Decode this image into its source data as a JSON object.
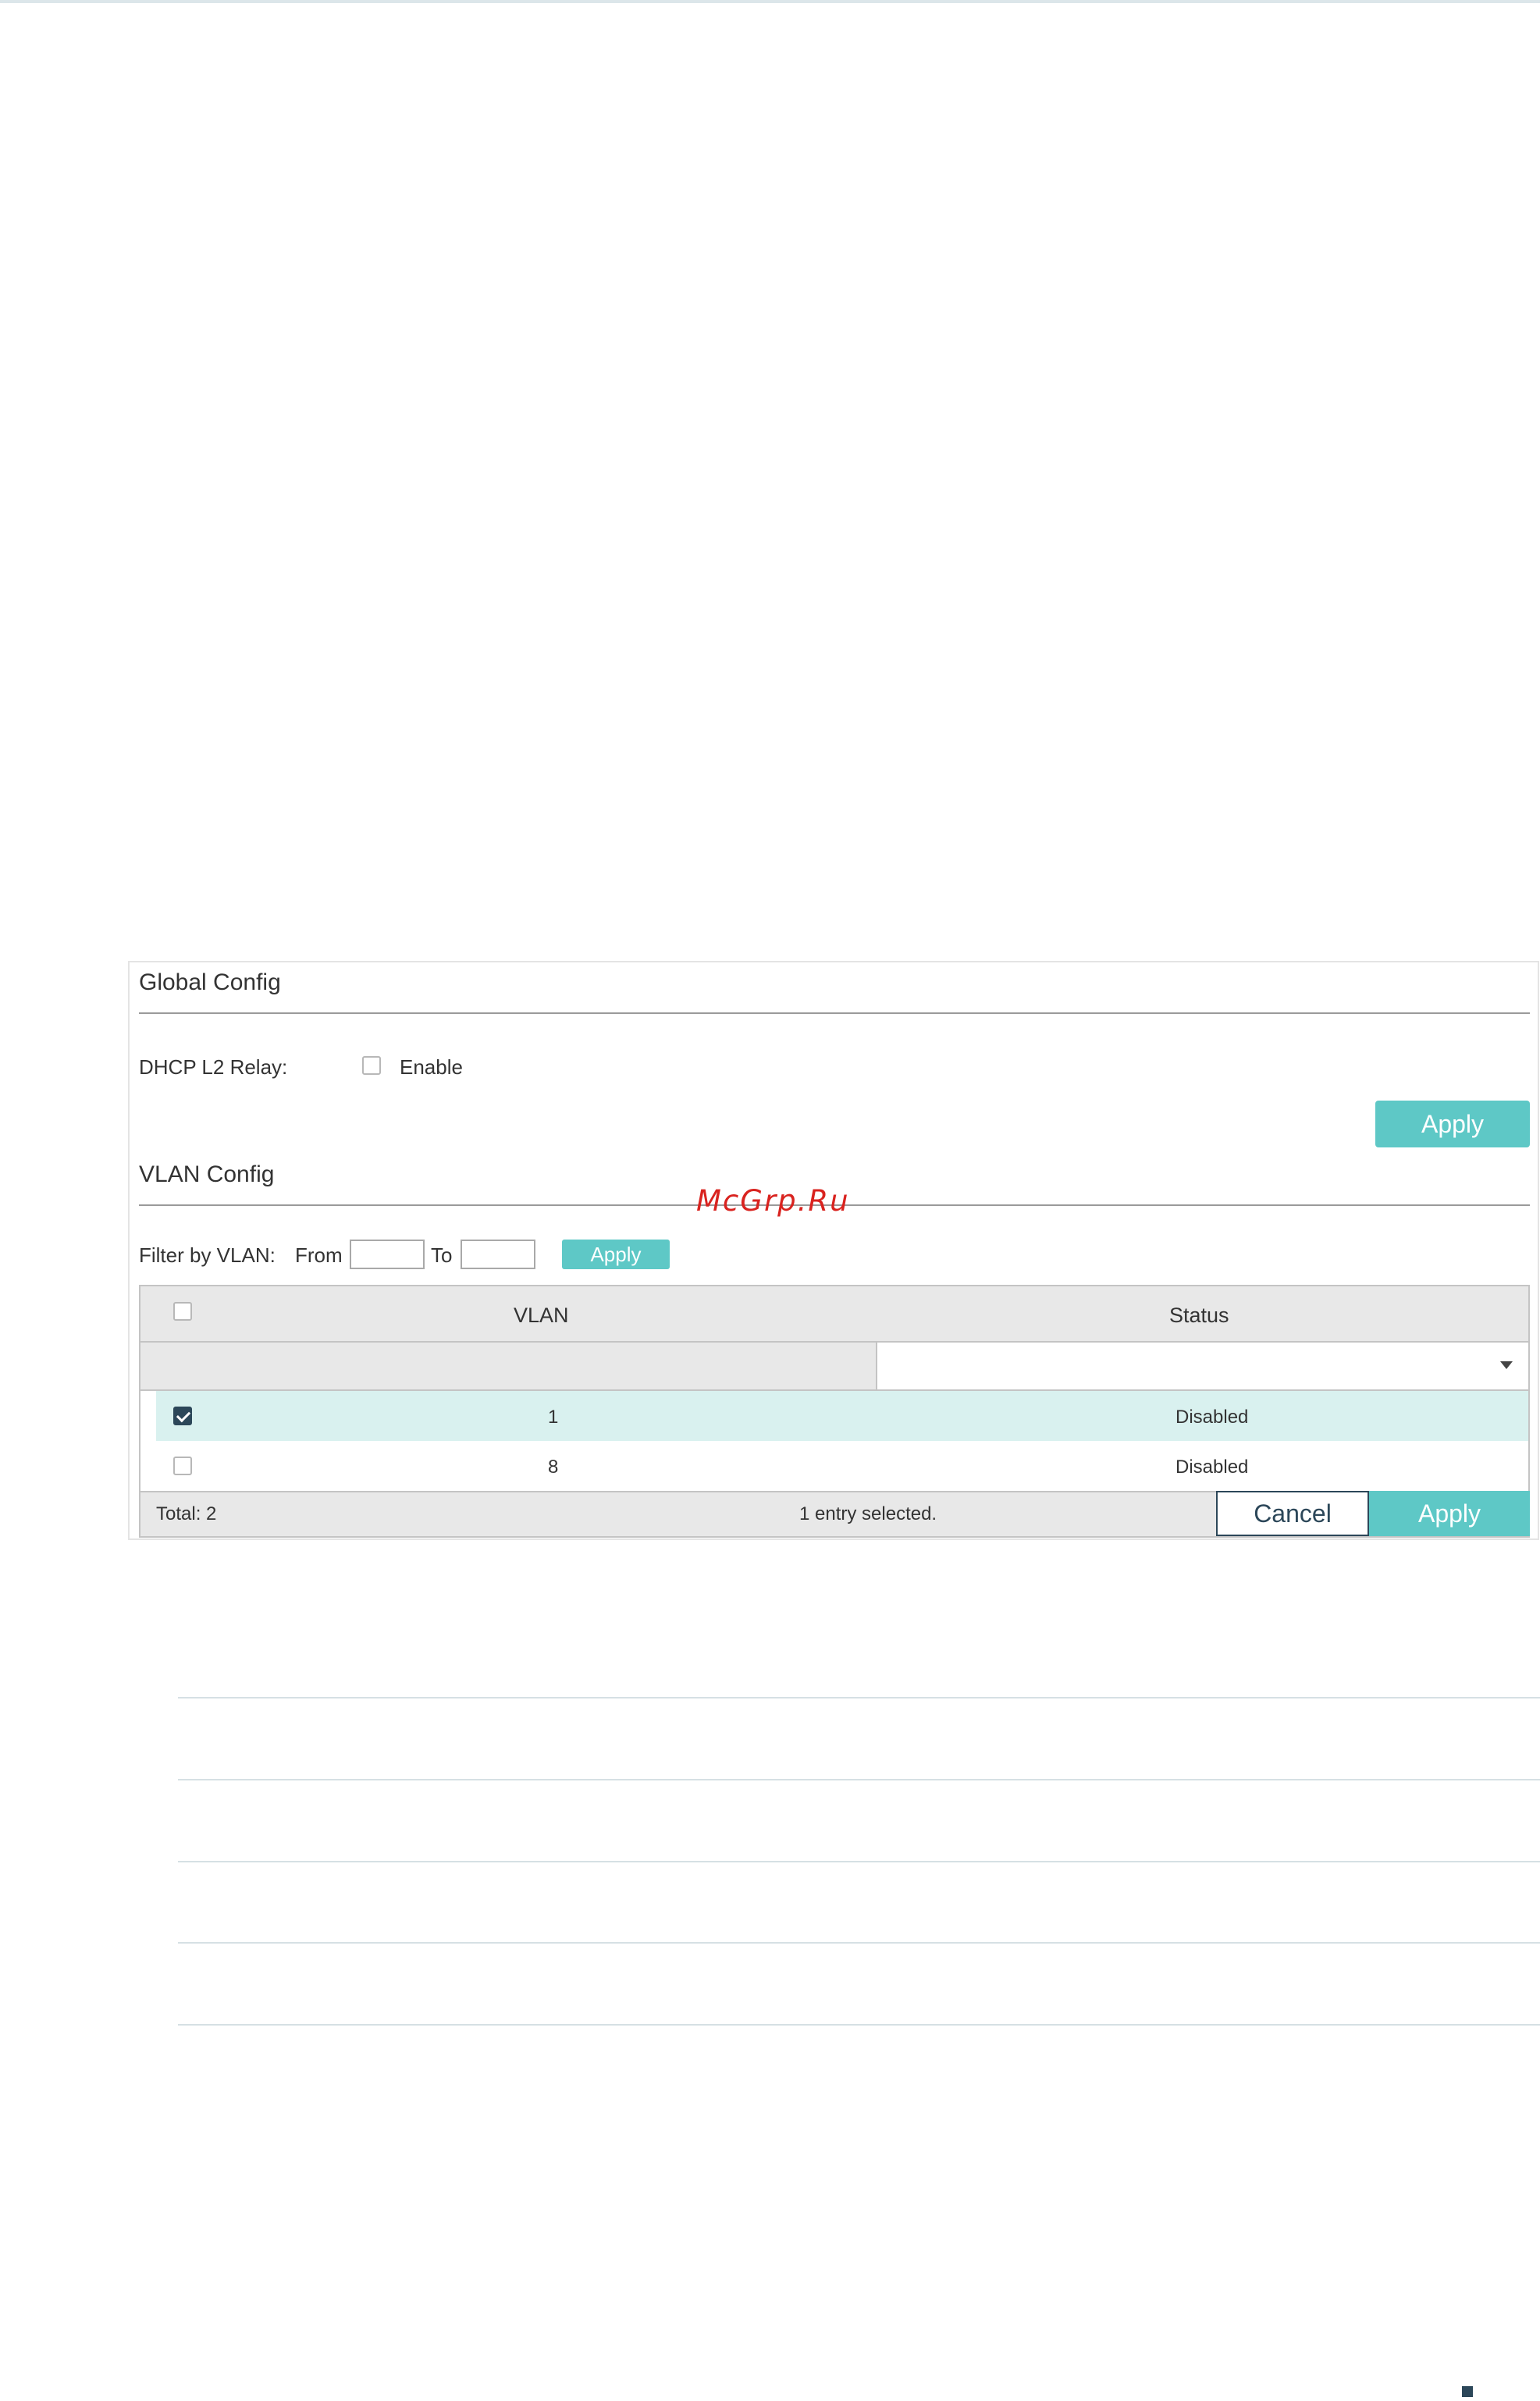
{
  "global_config": {
    "title": "Global Config",
    "relay_label": "DHCP L2 Relay:",
    "enable_label": "Enable",
    "enable_checked": false,
    "apply_label": "Apply"
  },
  "vlan_config": {
    "title": "VLAN Config",
    "filter_label": "Filter by VLAN:",
    "from_label": "From",
    "to_label": "To",
    "from_value": "",
    "to_value": "",
    "filter_apply_label": "Apply",
    "table": {
      "columns": [
        "VLAN",
        "Status"
      ],
      "status_filter_value": "",
      "rows": [
        {
          "vlan": "1",
          "status": "Disabled",
          "selected": true
        },
        {
          "vlan": "8",
          "status": "Disabled",
          "selected": false
        }
      ],
      "total": "Total: 2",
      "selection_text": "1 entry selected.",
      "cancel_label": "Cancel",
      "apply_label": "Apply"
    }
  },
  "watermark": "McGrp.Ru",
  "colors": {
    "accent": "#5ec8c6",
    "dark": "#2c4759",
    "selected_row": "#d9f1ef",
    "watermark": "#d9231f"
  }
}
